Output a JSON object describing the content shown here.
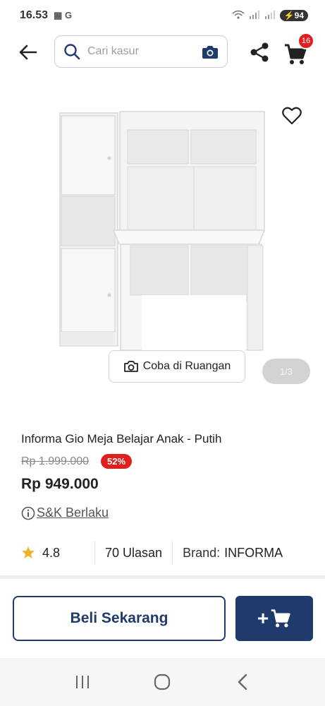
{
  "status_bar": {
    "time": "16.53",
    "battery": "94"
  },
  "search": {
    "placeholder": "Cari kasur"
  },
  "cart": {
    "badge_count": "16"
  },
  "gallery": {
    "try_in_room_label": "Coba di Ruangan",
    "pager": "1/3"
  },
  "product": {
    "title": "Informa Gio Meja Belajar Anak - Putih",
    "old_price": "Rp 1.999.000",
    "discount": "52%",
    "price": "Rp 949.000",
    "terms": "S&K Berlaku",
    "rating": "4.8",
    "reviews": "70 Ulasan",
    "brand_label": "Brand:",
    "brand": "INFORMA"
  },
  "actions": {
    "buy_now": "Beli Sekarang",
    "add_to_cart": "+"
  },
  "colors": {
    "primary": "#1f3a6d",
    "discount": "#e01f1f",
    "badge": "#e02020",
    "star": "#f0b429"
  },
  "icons": [
    "back-arrow-icon",
    "search-icon",
    "camera-icon",
    "share-icon",
    "cart-icon",
    "heart-icon",
    "info-icon",
    "star-icon",
    "recents-icon",
    "home-icon",
    "back-nav-icon"
  ]
}
